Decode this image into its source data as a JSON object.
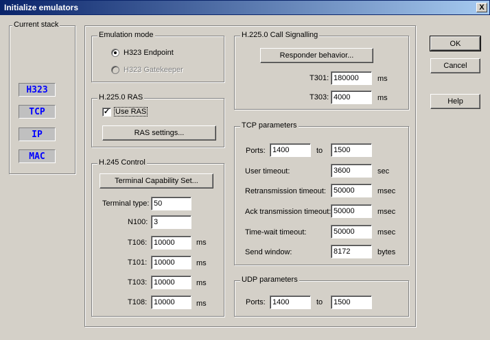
{
  "window": {
    "title": "Initialize emulators",
    "close_glyph": "X"
  },
  "stack": {
    "label": "Current stack",
    "items": [
      "H323",
      "TCP",
      "IP",
      "MAC"
    ]
  },
  "emulation_mode": {
    "label": "Emulation mode",
    "options": [
      {
        "label": "H323 Endpoint",
        "selected": true,
        "enabled": true
      },
      {
        "label": "H323 Gatekeeper",
        "selected": false,
        "enabled": false
      }
    ]
  },
  "ras": {
    "label": "H.225.0 RAS",
    "use_ras_label": "Use RAS",
    "use_ras_checked": true,
    "check_glyph": "✓",
    "settings_button": "RAS settings..."
  },
  "h245": {
    "label": "H.245 Control",
    "tcs_button": "Terminal Capability Set...",
    "fields": [
      {
        "label": "Terminal type:",
        "value": "50",
        "unit": ""
      },
      {
        "label": "N100:",
        "value": "3",
        "unit": ""
      },
      {
        "label": "T106:",
        "value": "10000",
        "unit": "ms"
      },
      {
        "label": "T101:",
        "value": "10000",
        "unit": "ms"
      },
      {
        "label": "T103:",
        "value": "10000",
        "unit": "ms"
      },
      {
        "label": "T108:",
        "value": "10000",
        "unit": "ms"
      }
    ]
  },
  "call_signalling": {
    "label": "H.225.0 Call Signalling",
    "responder_button": "Responder behavior...",
    "fields": [
      {
        "label": "T301:",
        "value": "180000",
        "unit": "ms"
      },
      {
        "label": "T303:",
        "value": "4000",
        "unit": "ms"
      }
    ]
  },
  "tcp": {
    "label": "TCP parameters",
    "ports_label": "Ports:",
    "port_from": "1400",
    "to_label": "to",
    "port_to": "1500",
    "fields": [
      {
        "label": "User timeout:",
        "value": "3600",
        "unit": "sec"
      },
      {
        "label": "Retransmission timeout:",
        "value": "50000",
        "unit": "msec"
      },
      {
        "label": "Ack transmission timeout:",
        "value": "50000",
        "unit": "msec"
      },
      {
        "label": "Time-wait timeout:",
        "value": "50000",
        "unit": "msec"
      },
      {
        "label": "Send window:",
        "value": "8172",
        "unit": "bytes"
      }
    ]
  },
  "udp": {
    "label": "UDP parameters",
    "ports_label": "Ports:",
    "port_from": "1400",
    "to_label": "to",
    "port_to": "1500"
  },
  "buttons": {
    "ok": "OK",
    "cancel": "Cancel",
    "help": "Help"
  }
}
